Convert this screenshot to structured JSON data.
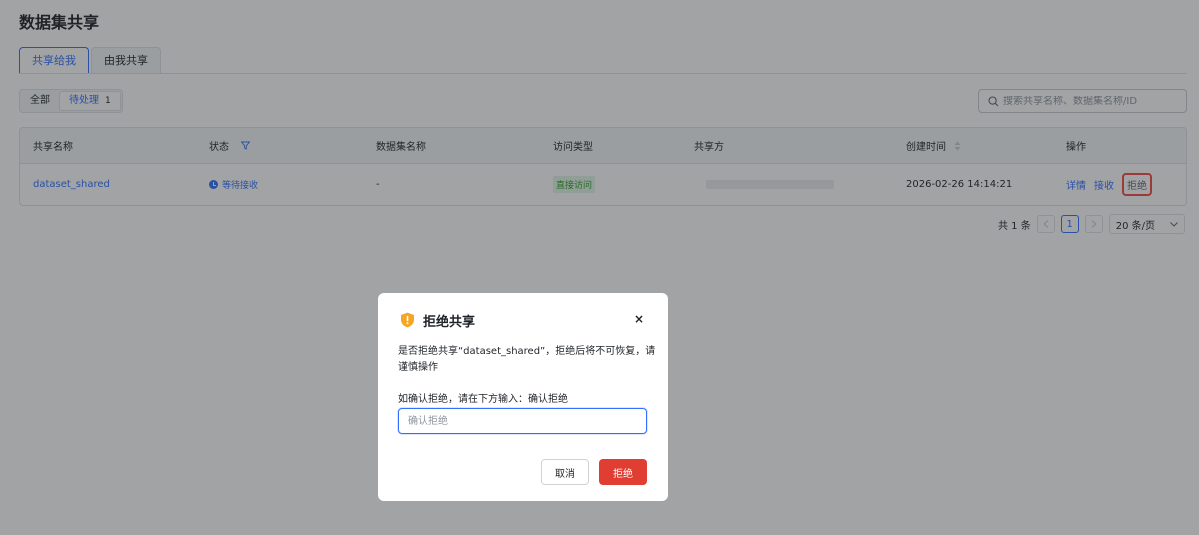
{
  "page": {
    "title": "数据集共享"
  },
  "tabs": [
    {
      "label": "共享给我",
      "active": true
    },
    {
      "label": "由我共享",
      "active": false
    }
  ],
  "filter": {
    "all_label": "全部",
    "pending_label": "待处理",
    "pending_count": "1"
  },
  "search": {
    "placeholder": "搜索共享名称、数据集名称/ID"
  },
  "table": {
    "columns": [
      "共享名称",
      "状态",
      "数据集名称",
      "访问类型",
      "共享方",
      "创建时间",
      "操作"
    ],
    "rows": [
      {
        "share_name": "dataset_shared",
        "status": "等待接收",
        "dataset_name": "-",
        "access_type": "直接访问",
        "sharer": "",
        "created_at": "2026-02-26 14:14:21",
        "actions": {
          "detail": "详情",
          "accept": "接收",
          "reject": "拒绝"
        }
      }
    ]
  },
  "pagination": {
    "total_text": "共 1 条",
    "current_page": "1",
    "page_size": "20 条/页"
  },
  "dialog": {
    "title": "拒绝共享",
    "message": "是否拒绝共享“dataset_shared”，拒绝后将不可恢复，请谨慎操作",
    "hint": "如确认拒绝，请在下方输入：确认拒绝",
    "input_placeholder": "确认拒绝",
    "input_value": "",
    "cancel_label": "取消",
    "confirm_label": "拒绝",
    "close_glyph": "×"
  },
  "colors": {
    "primary": "#3370ff",
    "danger": "#e03d33",
    "warning": "#f5a623",
    "success": "#2ea121"
  },
  "icons": [
    "search-icon",
    "filter-icon",
    "sort-icon",
    "status-icon",
    "warning-shield-icon",
    "close-icon",
    "chevron-left-icon",
    "chevron-right-icon",
    "chevron-down-icon"
  ]
}
